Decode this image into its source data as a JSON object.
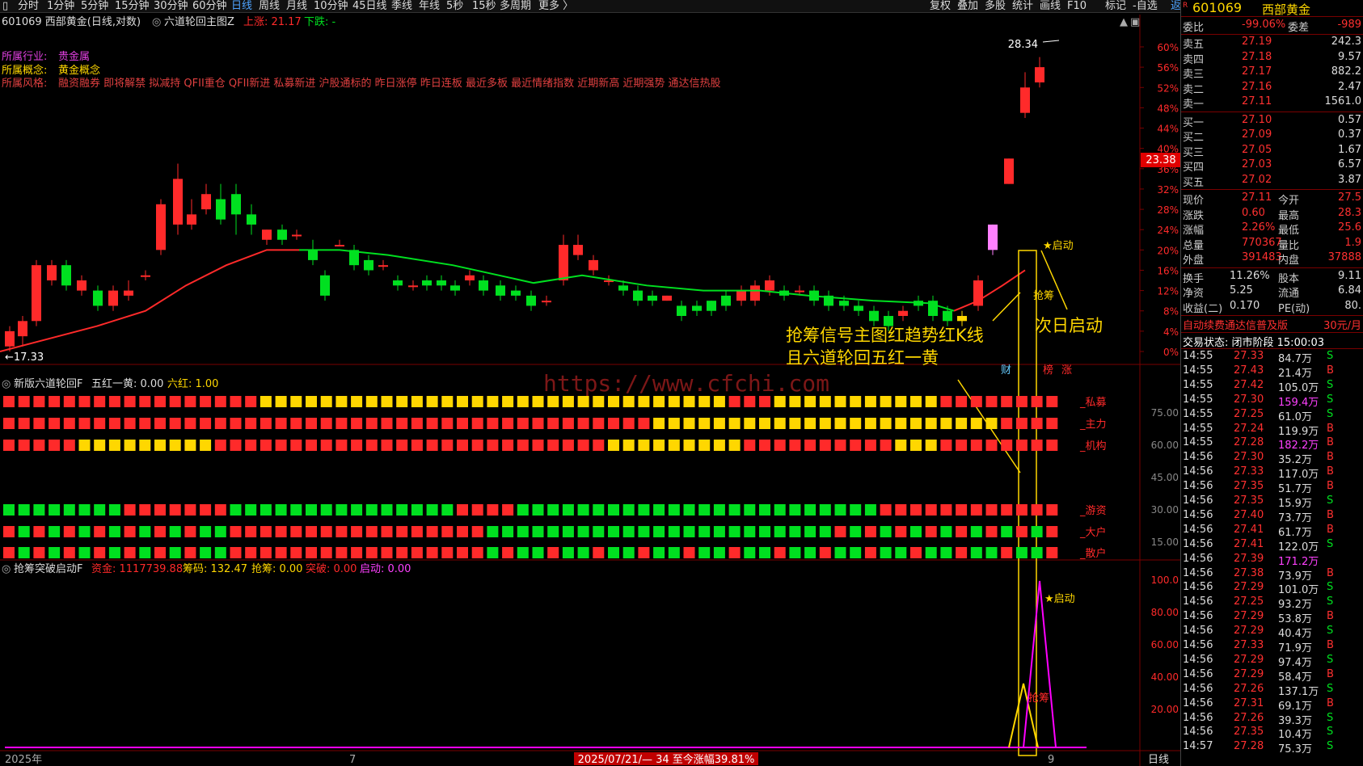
{
  "toolbar": {
    "periods": [
      "分时",
      "1分钟",
      "5分钟",
      "15分钟",
      "30分钟",
      "60分钟",
      "日线",
      "周线",
      "月线",
      "10分钟",
      "45日线",
      "季线",
      "年线",
      "5秒",
      "15秒",
      "多周期",
      "更多 〉"
    ],
    "active": "日线",
    "right_items": [
      "复权",
      "叠加",
      "多股",
      "统计",
      "画线",
      "F10",
      "标记",
      "-自选",
      "返回"
    ]
  },
  "chart_header": {
    "code_name": "601069 西部黄金(日线,对数)",
    "indicator": "六道轮回主图Z",
    "up_label": "上涨: 21.17",
    "down_label": "下跌: -"
  },
  "tags": {
    "industry_label": "所属行业:",
    "industry": "贵金属",
    "concept_label": "所属概念:",
    "concept": "黄金概念",
    "style_label": "所属风格:",
    "styles": "融资融券 即将解禁 拟减持 QFII重仓 QFII新进 私募新进 沪股通标的 昨日涨停 昨日连板 最近多板 最近情绪指数 近期新高 近期强势 通达信热股"
  },
  "price_axis": [
    "60%",
    "56%",
    "52%",
    "48%",
    "44%",
    "40%",
    "36%",
    "32%",
    "28%",
    "24%",
    "20%",
    "16%",
    "12%",
    "8%",
    "4%",
    "0%"
  ],
  "price_marks": {
    "high": "28.34",
    "low": "17.33",
    "current": "23.38"
  },
  "annotations": {
    "start1": "★启动",
    "grab": "抢筹",
    "callout_line1": "抢筹信号主图红趋势红K线",
    "callout_line2": "且六道轮回五红一黄",
    "next_day": "次日启动",
    "fin": "财",
    "bang": "榜",
    "zhang": "涨",
    "start2": "★启动",
    "grab2": "抢筹"
  },
  "watermark": "https://www.cfchi.com",
  "panel2": {
    "title": "新版六道轮回F",
    "five_red": "五红一黄: 0.00",
    "six_red": "六红: 1.00",
    "rows": [
      "私募",
      "主力",
      "机构",
      "游资",
      "大户",
      "散户"
    ],
    "axis": [
      "75.00",
      "60.00",
      "45.00",
      "30.00",
      "15.00"
    ]
  },
  "panel3": {
    "title": "抢筹突破启动F",
    "capital": "资金: 1117739.88",
    "chips": "筹码: 132.47",
    "grab": "抢筹: 0.00",
    "breakout": "突破: 0.00",
    "start": "启动: 0.00",
    "axis": [
      "100.0",
      "80.00",
      "60.00",
      "40.00",
      "20.00"
    ]
  },
  "bottom": {
    "left_date": "2025年",
    "mid_mark": "7",
    "right_mark": "9",
    "status": "2025/07/21/— 34 至今涨幅39.81%",
    "period": "日线"
  },
  "quote": {
    "code": "601069",
    "name": "西部黄金",
    "weibi_label": "委比",
    "weibi": "-99.06%",
    "weicha_label": "委差",
    "weicha": "-989",
    "sells": [
      [
        "卖五",
        "27.19",
        "242.3"
      ],
      [
        "卖四",
        "27.18",
        "9.57"
      ],
      [
        "卖三",
        "27.17",
        "882.2"
      ],
      [
        "卖二",
        "27.16",
        "2.47"
      ],
      [
        "卖一",
        "27.11",
        "1561.0"
      ]
    ],
    "buys": [
      [
        "买一",
        "27.10",
        "0.57"
      ],
      [
        "买二",
        "27.09",
        "0.37"
      ],
      [
        "买三",
        "27.05",
        "1.67"
      ],
      [
        "买四",
        "27.03",
        "6.57"
      ],
      [
        "买五",
        "27.02",
        "3.87"
      ]
    ],
    "stats": [
      [
        "现价",
        "27.11",
        "今开",
        "27.5"
      ],
      [
        "涨跌",
        "0.60",
        "最高",
        "28.3"
      ],
      [
        "涨幅",
        "2.26%",
        "最低",
        "25.6"
      ],
      [
        "总量",
        "770367",
        "量比",
        "1.9"
      ],
      [
        "外盘",
        "391483",
        "内盘",
        "37888"
      ]
    ],
    "stats2": [
      [
        "换手",
        "11.26%",
        "股本",
        "9.11"
      ],
      [
        "净资",
        "5.25",
        "流通",
        "6.84"
      ],
      [
        "收益(二)",
        "0.170",
        "PE(动)",
        "80."
      ]
    ],
    "ad_text": "自动续费通达信普及版",
    "ad_price": "30元/月",
    "trade_status": "交易状态: 闭市阶段 15:00:03",
    "ticks": [
      [
        "14:55",
        "27.33",
        "84.7万",
        "S"
      ],
      [
        "14:55",
        "27.43",
        "21.4万",
        "B"
      ],
      [
        "14:55",
        "27.42",
        "105.0万",
        "S"
      ],
      [
        "14:55",
        "27.30",
        "159.4万",
        "S"
      ],
      [
        "14:55",
        "27.25",
        "61.0万",
        "S"
      ],
      [
        "14:55",
        "27.24",
        "119.9万",
        "B"
      ],
      [
        "14:55",
        "27.28",
        "182.2万",
        "B"
      ],
      [
        "14:56",
        "27.30",
        "35.2万",
        "B"
      ],
      [
        "14:56",
        "27.33",
        "117.0万",
        "B"
      ],
      [
        "14:56",
        "27.35",
        "51.7万",
        "B"
      ],
      [
        "14:56",
        "27.35",
        "15.9万",
        "S"
      ],
      [
        "14:56",
        "27.40",
        "73.7万",
        "B"
      ],
      [
        "14:56",
        "27.41",
        "61.7万",
        "B"
      ],
      [
        "14:56",
        "27.41",
        "122.0万",
        "S"
      ],
      [
        "14:56",
        "27.39",
        "171.2万",
        ""
      ],
      [
        "14:56",
        "27.38",
        "73.9万",
        "B"
      ],
      [
        "14:56",
        "27.29",
        "101.0万",
        "S"
      ],
      [
        "14:56",
        "27.25",
        "93.2万",
        "S"
      ],
      [
        "14:56",
        "27.29",
        "53.8万",
        "B"
      ],
      [
        "14:56",
        "27.29",
        "40.4万",
        "S"
      ],
      [
        "14:56",
        "27.33",
        "71.9万",
        "B"
      ],
      [
        "14:56",
        "27.29",
        "97.4万",
        "S"
      ],
      [
        "14:56",
        "27.29",
        "58.4万",
        "B"
      ],
      [
        "14:56",
        "27.26",
        "137.1万",
        "S"
      ],
      [
        "14:56",
        "27.31",
        "69.1万",
        "B"
      ],
      [
        "14:56",
        "27.26",
        "39.3万",
        "S"
      ],
      [
        "14:56",
        "27.35",
        "10.4万",
        "S"
      ],
      [
        "14:57",
        "27.28",
        "75.3万",
        "S"
      ]
    ]
  },
  "colors": {
    "up": "#ff2a2a",
    "down": "#00e020",
    "yellow": "#ffd700",
    "magenta": "#ff00ff",
    "text": "#ccc"
  }
}
